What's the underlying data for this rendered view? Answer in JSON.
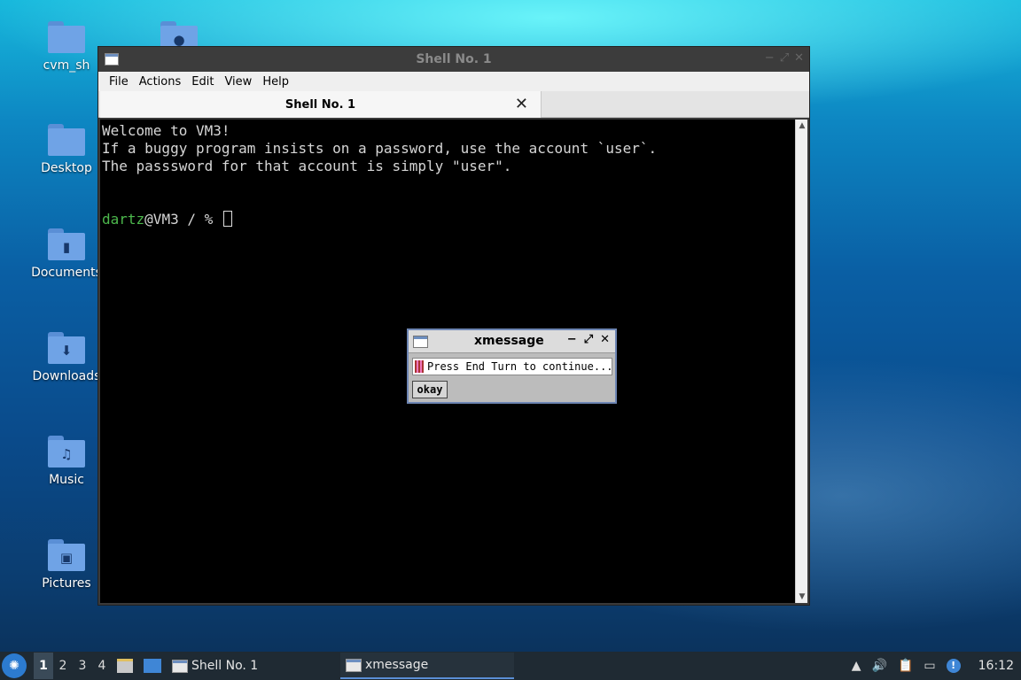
{
  "desktop": {
    "icons": [
      {
        "label": "cvm_sh",
        "glyph": ""
      },
      {
        "label": "Desktop",
        "glyph": ""
      },
      {
        "label": "Documents",
        "glyph": "▮"
      },
      {
        "label": "Downloads",
        "glyph": "⬇"
      },
      {
        "label": "Music",
        "glyph": "♫"
      },
      {
        "label": "Pictures",
        "glyph": "▣"
      }
    ],
    "partial_icon_glyph": "●"
  },
  "terminal_window": {
    "title": "Shell No. 1",
    "controls": {
      "minimize": "−",
      "maximize": "⤢",
      "close": "✕"
    },
    "menu": [
      "File",
      "Actions",
      "Edit",
      "View",
      "Help"
    ],
    "tab_label": "Shell No. 1",
    "tab_close": "✕",
    "lines": [
      "Welcome to VM3!",
      "If a buggy program insists on a password, use the account `user`.",
      "The passsword for that account is simply \"user\".",
      "",
      ""
    ],
    "prompt_user": "dartz",
    "prompt_rest": "@VM3 / % ",
    "scroll_up": "▲",
    "scroll_down": "▼"
  },
  "xmessage": {
    "title": "xmessage",
    "controls": {
      "minimize": "−",
      "maximize": "⤢",
      "close": "✕"
    },
    "message": "Press End Turn to continue...",
    "button": "okay"
  },
  "taskbar": {
    "start_glyph": "✺",
    "workspaces": [
      "1",
      "2",
      "3",
      "4"
    ],
    "active_workspace": "1",
    "tasks": [
      {
        "label": "Shell No. 1"
      },
      {
        "label": "xmessage"
      }
    ],
    "tray_icons": [
      "up-arrow-icon",
      "volume-icon",
      "clipboard-icon",
      "network-icon",
      "notification-icon"
    ],
    "tray_glyphs": {
      "up": "▲",
      "volume": "🔊",
      "clipboard": "📋",
      "network": "▭",
      "notify": "!"
    },
    "clock": "16:12"
  }
}
